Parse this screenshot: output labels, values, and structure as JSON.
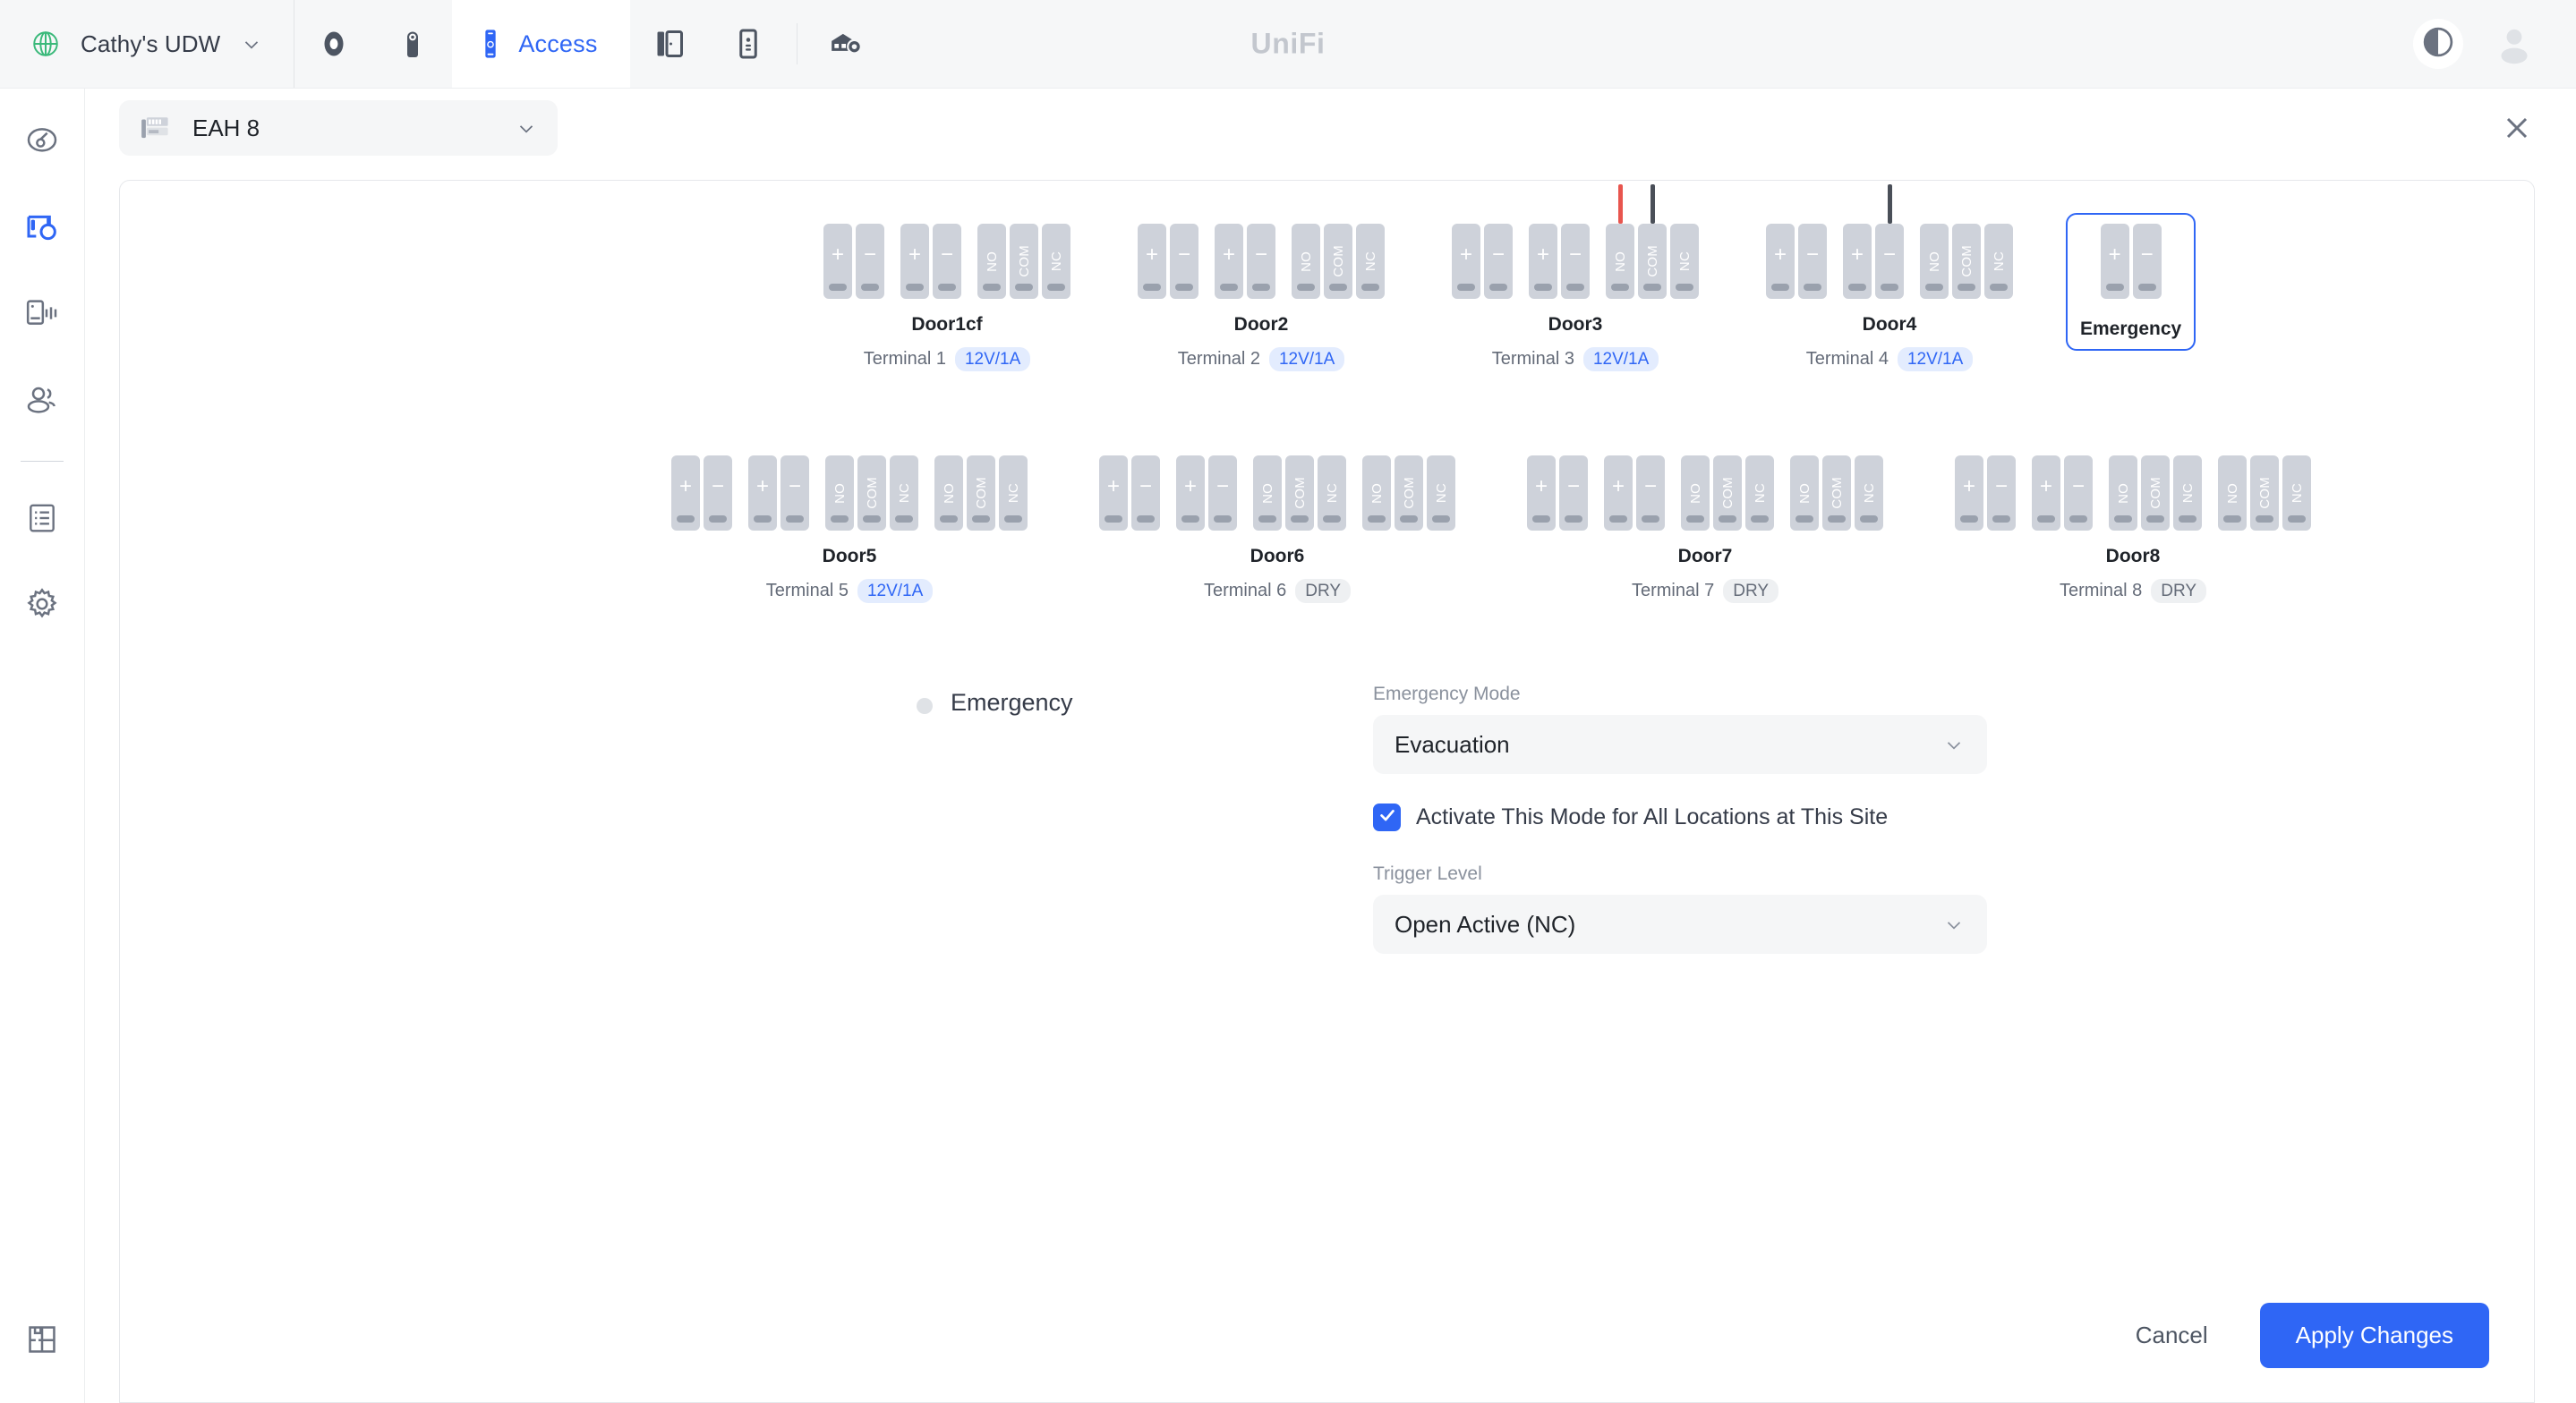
{
  "topbar": {
    "site_name": "Cathy's UDW",
    "globe_icon": "globe-icon",
    "caret_icon": "chevron-down-icon",
    "apps": [
      {
        "id": "protect",
        "icon": "protect-disc-icon",
        "label": "",
        "active": false
      },
      {
        "id": "camera",
        "icon": "camera-device-icon",
        "label": "",
        "active": false
      },
      {
        "id": "access",
        "icon": "access-reader-icon",
        "label": "Access",
        "active": true
      },
      {
        "id": "doors",
        "icon": "door-hub-icon",
        "label": "",
        "active": false
      },
      {
        "id": "intercom",
        "icon": "intercom-device-icon",
        "label": "",
        "active": false
      },
      {
        "id": "gateway",
        "icon": "gateway-settings-icon",
        "label": "",
        "active": false
      }
    ],
    "logo": "UniFi",
    "theme_icon": "contrast-toggle-icon",
    "avatar_icon": "user-avatar-icon"
  },
  "sidebar": {
    "items": [
      {
        "name": "sidebar-item-dashboard",
        "icon": "key-circle-icon",
        "active": false
      },
      {
        "name": "sidebar-item-doors",
        "icon": "door-key-icon",
        "active": true
      },
      {
        "name": "sidebar-item-devices",
        "icon": "reader-signal-icon",
        "active": false
      },
      {
        "name": "sidebar-item-users",
        "icon": "users-icon",
        "active": false
      }
    ],
    "items_secondary": [
      {
        "name": "sidebar-item-logs",
        "icon": "clipboard-list-icon",
        "active": false
      },
      {
        "name": "sidebar-item-settings",
        "icon": "gear-icon",
        "active": false
      }
    ],
    "bottom": {
      "name": "sidebar-item-floorplan",
      "icon": "floorplan-icon"
    }
  },
  "panel": {
    "device_name": "EAH 8",
    "device_icon": "access-hub-icon",
    "device_caret": "chevron-down-icon",
    "close_icon": "close-icon"
  },
  "terminals": {
    "row1": [
      {
        "name": "Door1cf",
        "terminal": "Terminal 1",
        "badge": "12V/1A",
        "badge_style": "blue",
        "selected": false,
        "groups": [
          [
            "+",
            "-"
          ],
          [
            "+",
            "-"
          ],
          [
            "NO",
            "COM",
            "NC"
          ]
        ],
        "wires": []
      },
      {
        "name": "Door2",
        "terminal": "Terminal 2",
        "badge": "12V/1A",
        "badge_style": "blue",
        "selected": false,
        "groups": [
          [
            "+",
            "-"
          ],
          [
            "+",
            "-"
          ],
          [
            "NO",
            "COM",
            "NC"
          ]
        ],
        "wires": []
      },
      {
        "name": "Door3",
        "terminal": "Terminal 3",
        "badge": "12V/1A",
        "badge_style": "blue",
        "selected": false,
        "groups": [
          [
            "+",
            "-"
          ],
          [
            "+",
            "-"
          ],
          [
            "NO",
            "COM",
            "NC"
          ]
        ],
        "wires": [
          {
            "pin": "NO",
            "color": "#e8554e"
          },
          {
            "pin": "COM",
            "color": "#4a4f58"
          }
        ]
      },
      {
        "name": "Door4",
        "terminal": "Terminal 4",
        "badge": "12V/1A",
        "badge_style": "blue",
        "selected": false,
        "groups": [
          [
            "+",
            "-"
          ],
          [
            "+",
            "-"
          ],
          [
            "NO",
            "COM",
            "NC"
          ]
        ],
        "wires": [
          {
            "pin": "-2",
            "color": "#4a4f58"
          }
        ]
      },
      {
        "name": "Emergency",
        "terminal": "",
        "badge": "",
        "badge_style": "",
        "selected": true,
        "groups": [
          [
            "+",
            "-"
          ]
        ],
        "wires": []
      }
    ],
    "row2": [
      {
        "name": "Door5",
        "terminal": "Terminal 5",
        "badge": "12V/1A",
        "badge_style": "blue",
        "selected": false,
        "groups": [
          [
            "+",
            "-"
          ],
          [
            "+",
            "-"
          ],
          [
            "NO",
            "COM",
            "NC"
          ],
          [
            "NO",
            "COM",
            "NC"
          ]
        ],
        "wires": []
      },
      {
        "name": "Door6",
        "terminal": "Terminal 6",
        "badge": "DRY",
        "badge_style": "gray",
        "selected": false,
        "groups": [
          [
            "+",
            "-"
          ],
          [
            "+",
            "-"
          ],
          [
            "NO",
            "COM",
            "NC"
          ],
          [
            "NO",
            "COM",
            "NC"
          ]
        ],
        "wires": []
      },
      {
        "name": "Door7",
        "terminal": "Terminal 7",
        "badge": "DRY",
        "badge_style": "gray",
        "selected": false,
        "groups": [
          [
            "+",
            "-"
          ],
          [
            "+",
            "-"
          ],
          [
            "NO",
            "COM",
            "NC"
          ],
          [
            "NO",
            "COM",
            "NC"
          ]
        ],
        "wires": []
      },
      {
        "name": "Door8",
        "terminal": "Terminal 8",
        "badge": "DRY",
        "badge_style": "gray",
        "selected": false,
        "groups": [
          [
            "+",
            "-"
          ],
          [
            "+",
            "-"
          ],
          [
            "NO",
            "COM",
            "NC"
          ],
          [
            "NO",
            "COM",
            "NC"
          ]
        ],
        "wires": []
      }
    ]
  },
  "form": {
    "emergency_label": "Emergency",
    "emergency_mode_label": "Emergency Mode",
    "emergency_mode_value": "Evacuation",
    "activate_all_label": "Activate This Mode for All Locations at This Site",
    "activate_all_checked": true,
    "trigger_level_label": "Trigger Level",
    "trigger_level_value": "Open Active (NC)",
    "caret_icon": "chevron-down-icon",
    "check_icon": "check-icon"
  },
  "footer": {
    "cancel_label": "Cancel",
    "apply_label": "Apply Changes"
  },
  "colors": {
    "accent": "#2f66f5",
    "pin": "#ced2da",
    "wire_red": "#e8554e",
    "wire_black": "#4a4f58"
  }
}
